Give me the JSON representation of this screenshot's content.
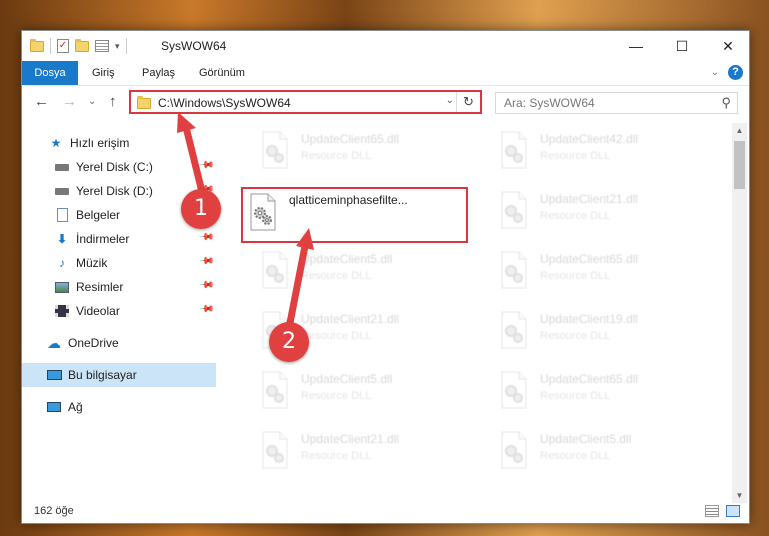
{
  "window": {
    "title": "SysWOW64",
    "minimize": "—",
    "maximize": "☐",
    "close": "✕"
  },
  "ribbon": {
    "tabs": [
      "Dosya",
      "Giriş",
      "Paylaş",
      "Görünüm"
    ],
    "help": "?",
    "expand": "⌄"
  },
  "navigation": {
    "back": "←",
    "forward": "→",
    "recent": "⌄",
    "up": "↑",
    "address": "C:\\Windows\\SysWOW64",
    "address_dropdown": "⌄",
    "refresh": "↻",
    "search_placeholder": "Ara: SysWOW64",
    "search_icon": "⚲"
  },
  "sidebar": {
    "items": [
      {
        "label": "Hızlı erişim",
        "icon": "star-icon"
      },
      {
        "label": "Yerel Disk (C:)",
        "icon": "drive-icon"
      },
      {
        "label": "Yerel Disk (D:)",
        "icon": "drive-icon"
      },
      {
        "label": "Belgeler",
        "icon": "documents-icon"
      },
      {
        "label": "İndirmeler",
        "icon": "download-icon"
      },
      {
        "label": "Müzik",
        "icon": "music-icon"
      },
      {
        "label": "Resimler",
        "icon": "pictures-icon"
      },
      {
        "label": "Videolar",
        "icon": "videos-icon"
      },
      {
        "label": "OneDrive",
        "icon": "cloud-icon"
      },
      {
        "label": "Bu bilgisayar",
        "icon": "computer-icon"
      },
      {
        "label": "Ağ",
        "icon": "network-icon"
      }
    ]
  },
  "files": {
    "highlighted": {
      "name": "qlatticeminphasefilte...",
      "type": ""
    },
    "tiles": [
      {
        "name": "UpdateClient65.dll",
        "type": "Resource DLL"
      },
      {
        "name": "UpdateClient42.dll",
        "type": "Resource DLL"
      },
      {
        "name": "UpdateClient21.dll",
        "type": "Resource DLL"
      },
      {
        "name": "UpdateClient5.dll",
        "type": "Resource DLL"
      },
      {
        "name": "UpdateClient65.dll",
        "type": "Resource DLL"
      },
      {
        "name": "UpdateClient21.dll",
        "type": "Resource DLL"
      },
      {
        "name": "UpdateClient19.dll",
        "type": "Resource DLL"
      },
      {
        "name": "UpdateClient5.dll",
        "type": "Resource DLL"
      },
      {
        "name": "UpdateClient65.dll",
        "type": "Resource DLL"
      },
      {
        "name": "UpdateClient21.dll",
        "type": "Resource DLL"
      },
      {
        "name": "UpdateClient5.dll",
        "type": "Resource DLL"
      }
    ]
  },
  "status": {
    "count": "162 öğe"
  },
  "callouts": [
    "1",
    "2"
  ],
  "colors": {
    "accent": "#1979ca",
    "highlight": "#d9363e",
    "callout": "#e04040",
    "selection": "#cce4f7"
  }
}
